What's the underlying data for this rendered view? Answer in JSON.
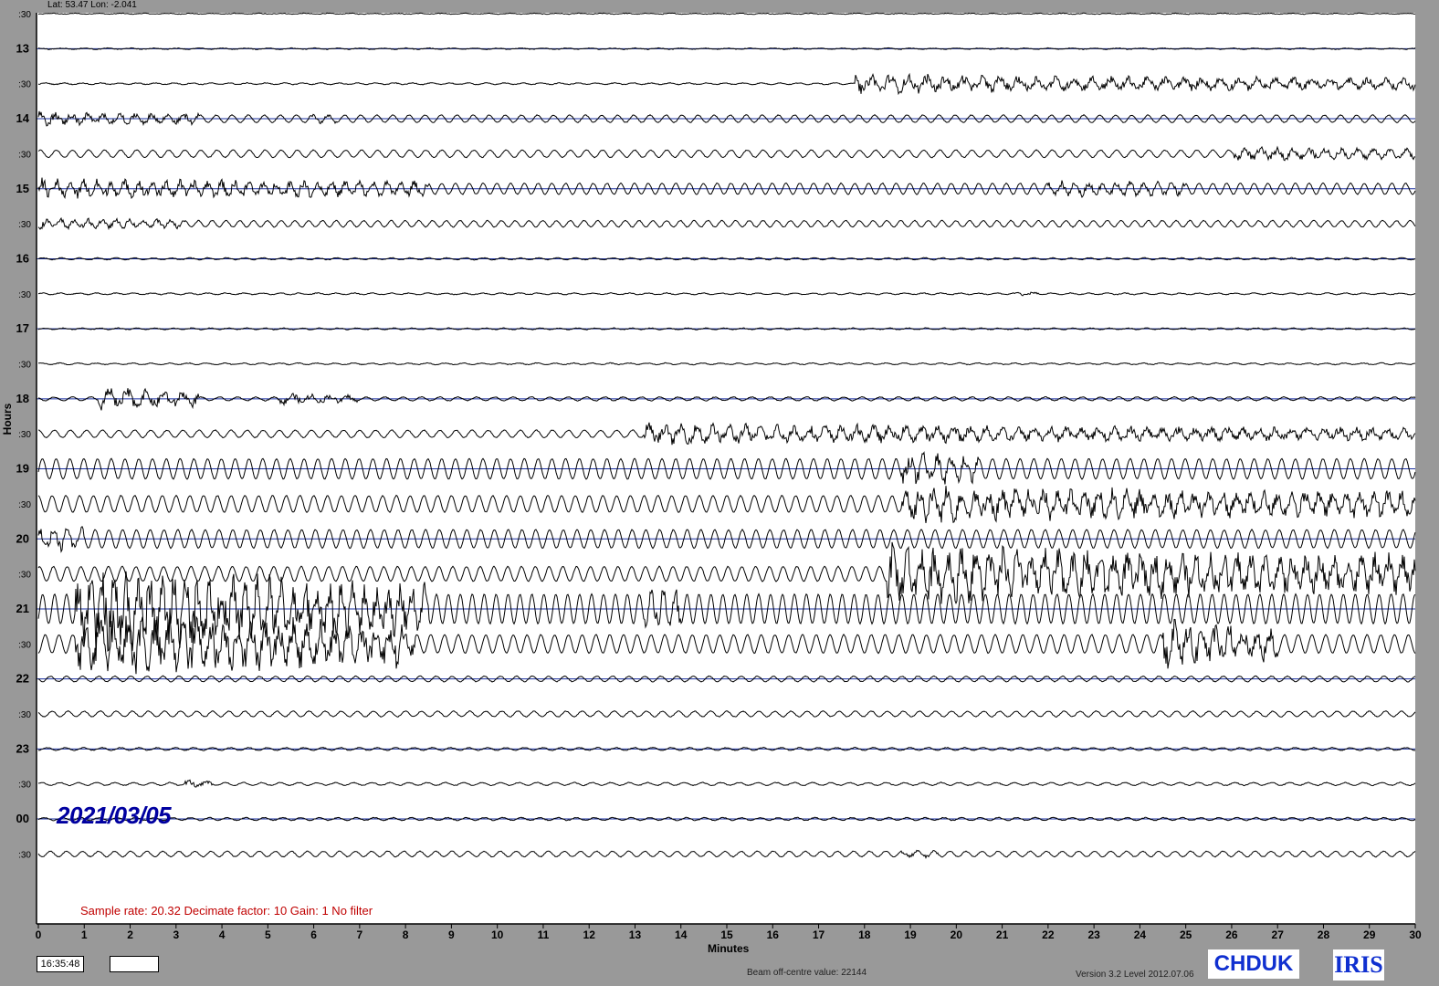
{
  "header": {
    "latlon": "Lat: 53.47 Lon: -2.041"
  },
  "axes": {
    "xlabel": "Minutes",
    "ylabel": "Hours"
  },
  "date_label": "2021/03/05",
  "info_line": "Sample rate: 20.32  Decimate factor: 10  Gain: 1  No filter",
  "footer": {
    "time": "16:35:48",
    "beam": "Beam off-centre value: 22144",
    "version": "Version 3.2 Level 2012.07.06",
    "logo_station": "CHDUK",
    "logo_iris": "IRIS"
  },
  "colors": {
    "background": "#999999",
    "plot": "#ffffff",
    "trace": "#000000",
    "hour_line": "#1a2fa0",
    "date": "#0000a0",
    "info": "#c00000"
  },
  "chart_data": {
    "type": "line",
    "title": "",
    "xlabel": "Minutes",
    "ylabel": "Hours",
    "xlim": [
      0,
      30
    ],
    "x_ticks": [
      "0",
      "1",
      "2",
      "3",
      "4",
      "5",
      "6",
      "7",
      "8",
      "9",
      "10",
      "11",
      "12",
      "13",
      "14",
      "15",
      "16",
      "17",
      "18",
      "19",
      "20",
      "21",
      "22",
      "23",
      "24",
      "25",
      "26",
      "27",
      "28",
      "29",
      "30"
    ],
    "y_ticks": [
      ":30",
      "13",
      ":30",
      "14",
      ":30",
      "15",
      ":30",
      "16",
      ":30",
      "17",
      ":30",
      "18",
      ":30",
      "19",
      ":30",
      "20",
      ":30",
      "21",
      ":30",
      "22",
      ":30",
      "23",
      ":30",
      "00",
      ":30"
    ],
    "traces": [
      {
        "label": ":30",
        "amp": 0.4,
        "period": 0.5,
        "events": []
      },
      {
        "label": "13",
        "amp": 0.6,
        "period": 0.5,
        "events": []
      },
      {
        "label": ":30",
        "amp": 0.8,
        "period": 0.4,
        "events": [
          {
            "start": 17.8,
            "end": 30,
            "amp": 11
          }
        ]
      },
      {
        "label": "14",
        "amp": 4,
        "period": 0.35,
        "events": [
          {
            "start": 0,
            "end": 3.5,
            "amp": 8
          },
          {
            "start": 5.8,
            "end": 6.5,
            "amp": 5
          }
        ]
      },
      {
        "label": ":30",
        "amp": 4,
        "period": 0.35,
        "events": [
          {
            "start": 26,
            "end": 30,
            "amp": 8
          }
        ]
      },
      {
        "label": "15",
        "amp": 6,
        "period": 0.3,
        "events": [
          {
            "start": 0,
            "end": 8.5,
            "amp": 12
          },
          {
            "start": 22,
            "end": 25,
            "amp": 8
          }
        ]
      },
      {
        "label": ":30",
        "amp": 3.5,
        "period": 0.3,
        "events": [
          {
            "start": 0,
            "end": 3.2,
            "amp": 6
          }
        ]
      },
      {
        "label": "16",
        "amp": 1,
        "period": 0.4,
        "events": []
      },
      {
        "label": ":30",
        "amp": 0.8,
        "period": 0.4,
        "events": [
          {
            "start": 21.3,
            "end": 21.8,
            "amp": 3
          }
        ]
      },
      {
        "label": "17",
        "amp": 0.8,
        "period": 0.4,
        "events": []
      },
      {
        "label": ":30",
        "amp": 0.8,
        "period": 0.4,
        "events": []
      },
      {
        "label": "18",
        "amp": 2,
        "period": 0.4,
        "events": [
          {
            "start": 1.3,
            "end": 3.5,
            "amp": 14
          },
          {
            "start": 5.2,
            "end": 7.0,
            "amp": 7
          }
        ]
      },
      {
        "label": ":30",
        "amp": 4,
        "period": 0.35,
        "events": [
          {
            "start": 13.2,
            "end": 30,
            "amp": 12
          }
        ]
      },
      {
        "label": "19",
        "amp": 11,
        "period": 0.3,
        "events": [
          {
            "start": 18.8,
            "end": 20.5,
            "amp": 20
          }
        ]
      },
      {
        "label": ":30",
        "amp": 9,
        "period": 0.3,
        "events": [
          {
            "start": 18.8,
            "end": 30,
            "amp": 22
          }
        ]
      },
      {
        "label": "20",
        "amp": 10,
        "period": 0.3,
        "events": [
          {
            "start": 0,
            "end": 1.0,
            "amp": 14
          }
        ]
      },
      {
        "label": ":30",
        "amp": 8,
        "period": 0.3,
        "events": [
          {
            "start": 18.5,
            "end": 30,
            "amp": 35
          }
        ]
      },
      {
        "label": "21",
        "amp": 16,
        "period": 0.26,
        "events": [
          {
            "start": 0.8,
            "end": 8.5,
            "amp": 50
          },
          {
            "start": 13.2,
            "end": 14.0,
            "amp": 30
          }
        ]
      },
      {
        "label": ":30",
        "amp": 10,
        "period": 0.3,
        "events": [
          {
            "start": 0.8,
            "end": 8.2,
            "amp": 40
          },
          {
            "start": 24.5,
            "end": 27.0,
            "amp": 30
          }
        ]
      },
      {
        "label": "22",
        "amp": 3,
        "period": 0.35,
        "events": []
      },
      {
        "label": ":30",
        "amp": 3,
        "period": 0.35,
        "events": []
      },
      {
        "label": "23",
        "amp": 1.5,
        "period": 0.4,
        "events": []
      },
      {
        "label": ":30",
        "amp": 1.5,
        "period": 0.4,
        "events": [
          {
            "start": 3.2,
            "end": 3.8,
            "amp": 5
          }
        ]
      },
      {
        "label": "00",
        "amp": 1.5,
        "period": 0.4,
        "events": []
      },
      {
        "label": ":30",
        "amp": 3,
        "period": 0.35,
        "events": [
          {
            "start": 18.8,
            "end": 19.6,
            "amp": 5
          }
        ]
      }
    ]
  }
}
